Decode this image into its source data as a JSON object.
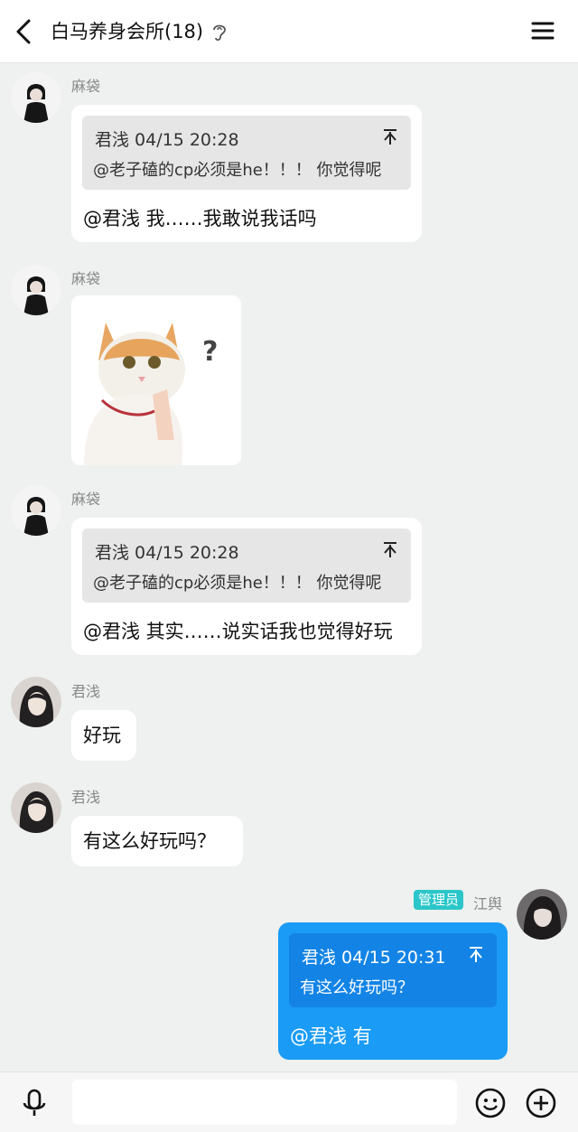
{
  "header": {
    "title": "白马养身会所(18)"
  },
  "messages": [
    {
      "sender": "麻袋",
      "quote_meta": "君浅 04/15 20:28",
      "quote_text": "@老子磕的cp必须是he！！！ 你觉得呢",
      "text": "@君浅 我……我敢说我话吗"
    },
    {
      "sender": "麻袋",
      "sticker_mark": "?"
    },
    {
      "sender": "麻袋",
      "quote_meta": "君浅 04/15 20:28",
      "quote_text": "@老子磕的cp必须是he！！！ 你觉得呢",
      "text": "@君浅 其实……说实话我也觉得好玩"
    },
    {
      "sender": "君浅",
      "text": "好玩"
    },
    {
      "sender": "君浅",
      "text": "有这么好玩吗？"
    },
    {
      "sender": "江舆",
      "badge": "管理员",
      "quote_meta": "君浅 04/15 20:31",
      "quote_text": "有这么好玩吗？",
      "text": "@君浅 有"
    }
  ],
  "colors": {
    "background": "#eef1ef",
    "my_bubble": "#1a9bf5",
    "admin_badge": "#2ac6c9"
  },
  "icons": {
    "back": "chevron-left-icon",
    "ear": "ear-icon",
    "menu": "hamburger-icon",
    "mic": "microphone-icon",
    "emoji": "smiley-icon",
    "plus": "plus-circle-icon"
  }
}
